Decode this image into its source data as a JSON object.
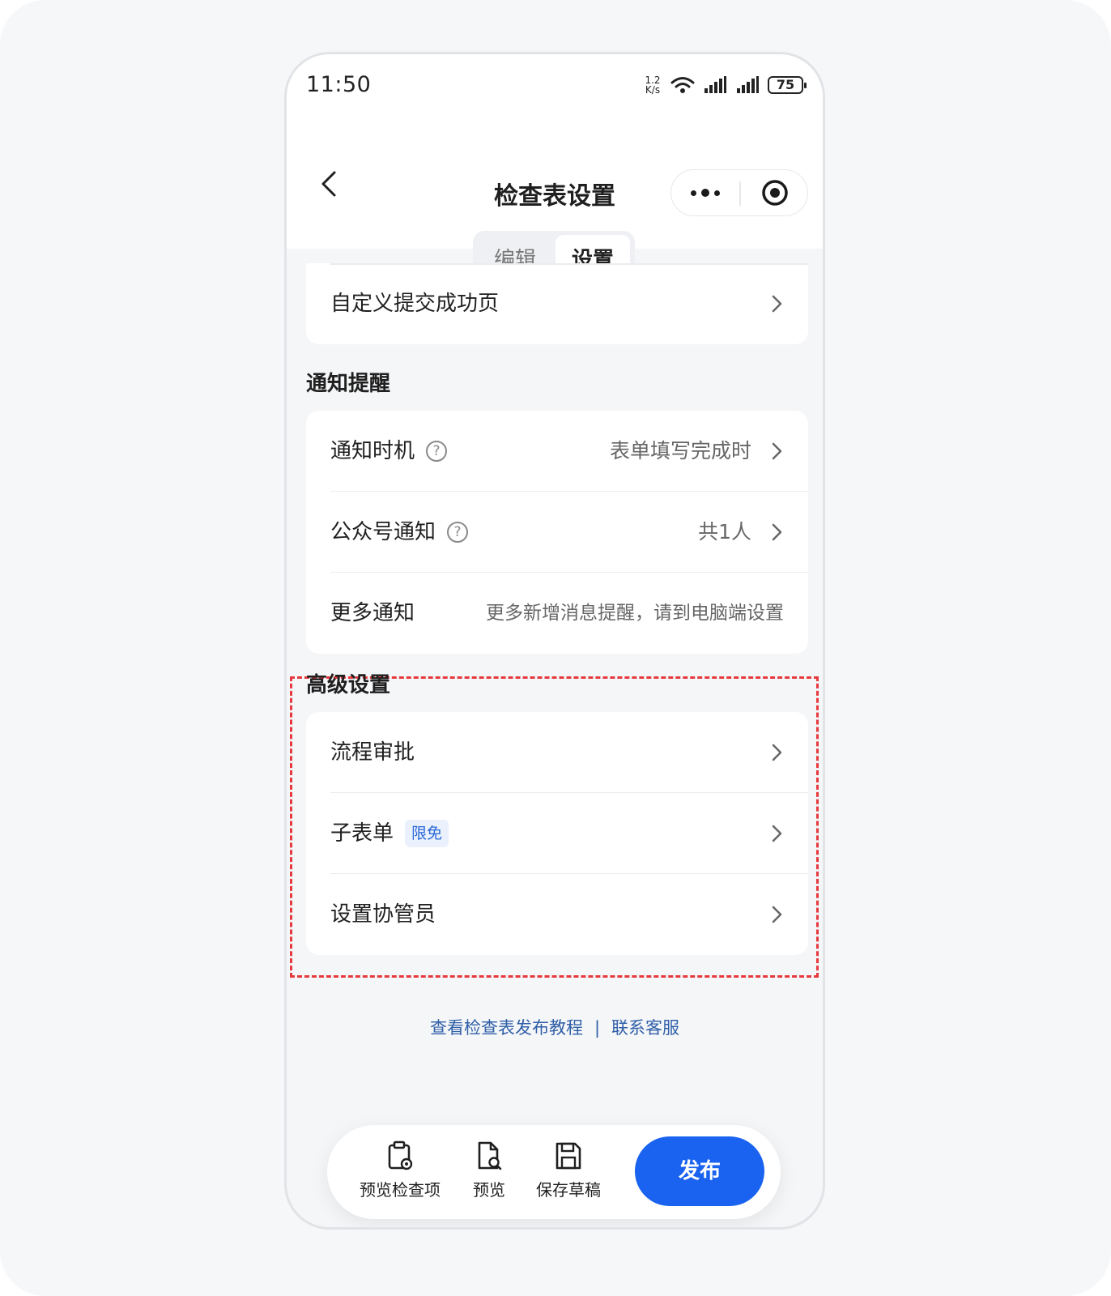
{
  "status": {
    "time": "11:50",
    "net_speed_top": "1.2",
    "net_speed_bottom": "K/s",
    "battery": "75"
  },
  "nav": {
    "title": "检查表设置"
  },
  "tabs": [
    {
      "label": "编辑",
      "active": false
    },
    {
      "label": "设置",
      "active": true
    }
  ],
  "top_card": {
    "items": [
      {
        "label": "自定义提交成功页"
      }
    ]
  },
  "notify_section": {
    "title": "通知提醒",
    "items": [
      {
        "label": "通知时机",
        "value": "表单填写完成时"
      },
      {
        "label": "公众号通知",
        "value": "共1人"
      },
      {
        "label": "更多通知",
        "value": "更多新增消息提醒，请到电脑端设置"
      }
    ]
  },
  "advanced_section": {
    "title": "高级设置",
    "items": [
      {
        "label": "流程审批"
      },
      {
        "label": "子表单",
        "badge": "限免"
      },
      {
        "label": "设置协管员"
      }
    ]
  },
  "footer": {
    "tutorial_link": "查看检查表发布教程",
    "separator": "|",
    "support_link": "联系客服"
  },
  "bottom_bar": {
    "preview_items": "预览检查项",
    "preview": "预览",
    "save_draft": "保存草稿",
    "publish": "发布"
  },
  "colors": {
    "accent": "#1a62f0",
    "link": "#2f5fa8",
    "highlight_border": "#e6393e",
    "badge_text": "#2a68d8"
  }
}
